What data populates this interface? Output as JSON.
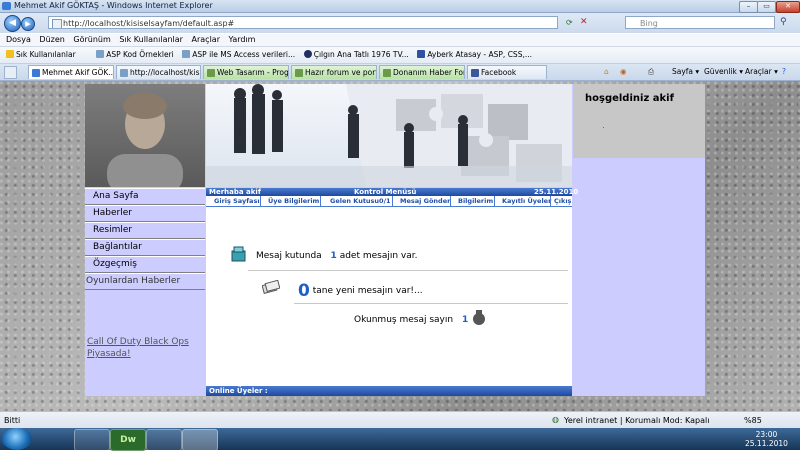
{
  "window": {
    "title": "Mehmet Akif GÖKTAŞ - Windows Internet Explorer"
  },
  "address": {
    "url": "http://localhost/kisiselsayfam/default.asp#",
    "search_placeholder": "Bing"
  },
  "menu": [
    "Dosya",
    "Düzen",
    "Görünüm",
    "Sık Kullanılanlar",
    "Araçlar",
    "Yardım"
  ],
  "favorites": {
    "label": "Sık Kullanılanlar",
    "items": [
      "ASP Kod Örnekleri",
      "ASP ile MS Access verileri...",
      "Çılgın Ana Tatlı 1976 TV...",
      "Ayberk Atasay - ASP, CSS,..."
    ]
  },
  "tabs": [
    "Mehmet Akif GÖK...",
    "http://localhost/kisis...",
    "Web Tasarım - Progr...",
    "Hazır forum ve portal...",
    "Donanım Haber Foru...",
    "Facebook"
  ],
  "commands": {
    "page": "Sayfa",
    "safety": "Güvenlik",
    "tools": "Araçlar"
  },
  "site": {
    "welcome": "hoşgeldiniz akif",
    "left_menu": [
      "Ana Sayfa",
      "Haberler",
      "Resimler",
      "Bağlantılar",
      "Özgeçmiş"
    ],
    "news_heading": "Oyunlardan Haberler",
    "news_link": "Call Of Duty Black Ops Piyasada!",
    "header_greeting": "Merhaba akif",
    "header_title": "Kontrol Menüsü",
    "header_date": "25.11.2010",
    "control_menu": [
      "Giriş Sayfası",
      "Üye Bilgilerim",
      "Gelen Kutusu0/1",
      "Mesaj Gönder",
      "Bilgilerim",
      "Kayıtlı Üyeler",
      "Çıkış"
    ],
    "inbox_prefix": "Mesaj kutunda",
    "inbox_count": "1",
    "inbox_suffix": "adet mesajın var.",
    "new_count": "0",
    "new_suffix": "tane yeni mesajın var!...",
    "read_prefix": "Okunmuş mesaj sayın",
    "read_count": "1",
    "online_label": "Online Üyeler :"
  },
  "status": {
    "left": "Bitti",
    "zone": "Yerel intranet | Korumalı Mod: Kapalı",
    "zoom": "%85"
  },
  "taskbar": {
    "time": "23:00",
    "date": "25.11.2010"
  }
}
